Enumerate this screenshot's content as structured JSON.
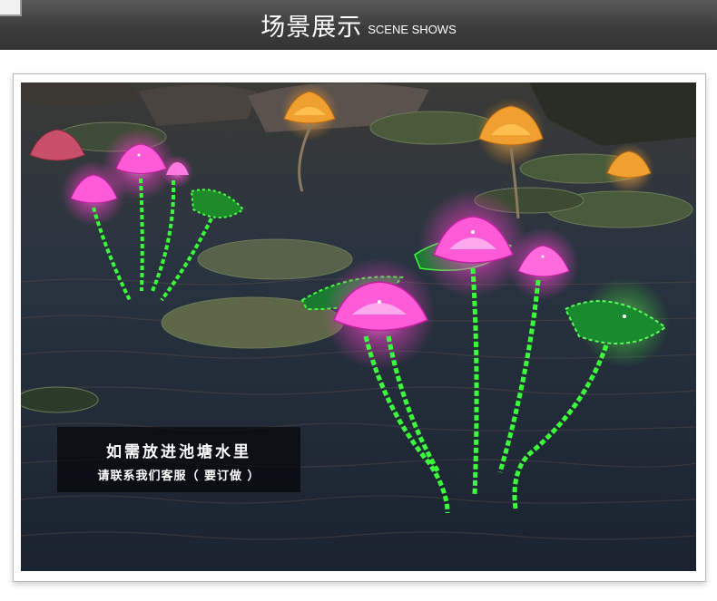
{
  "header": {
    "title_zh": "场景展示",
    "title_en": "SCENE SHOWS"
  },
  "caption": {
    "line1": "如需放进池塘水里",
    "line2": "请联系我们客服（ 要订做 ）"
  },
  "colors": {
    "header_bg": "#3c3c3c",
    "lotus_pink": "#ff4fd8",
    "stem_green": "#3cff3c",
    "lotus_orange": "#f0a030",
    "water": "#1b2430"
  }
}
